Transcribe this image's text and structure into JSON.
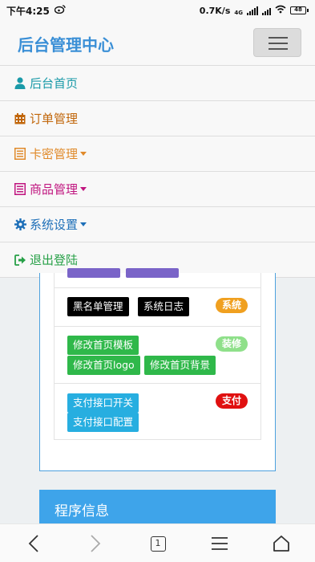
{
  "status_bar": {
    "time": "下午4:25",
    "speed": "0.7K/s",
    "network": "4G",
    "battery": "48"
  },
  "header": {
    "title": "后台管理中心"
  },
  "nav": [
    {
      "label": "后台首页",
      "icon": "user-icon",
      "color": "#1a9aa8"
    },
    {
      "label": "订单管理",
      "icon": "calendar-icon",
      "color": "#c1660a"
    },
    {
      "label": "卡密管理",
      "icon": "list-icon",
      "color": "#e08a2a",
      "dropdown": true
    },
    {
      "label": "商品管理",
      "icon": "list-icon",
      "color": "#c0157f",
      "dropdown": true
    },
    {
      "label": "系统设置",
      "icon": "gear-icon",
      "color": "#1d6fb8",
      "dropdown": true
    },
    {
      "label": "退出登陆",
      "icon": "sign-out-icon",
      "color": "#27a047"
    }
  ],
  "groups": [
    {
      "badge": "系统",
      "badge_color": "#f0a020",
      "buttons": [
        "黑名单管理",
        "系统日志"
      ],
      "button_color": "#000000"
    },
    {
      "badge": "装修",
      "badge_color": "#8fe08a",
      "buttons": [
        "修改首页模板",
        "修改首页logo",
        "修改首页背景"
      ],
      "button_color": "#2fb84a"
    },
    {
      "badge": "支付",
      "badge_color": "#e01010",
      "buttons": [
        "支付接口开关",
        "支付接口配置"
      ],
      "button_color": "#27aee0"
    }
  ],
  "info_panel": {
    "title": "程序信息"
  },
  "browser_bar": {
    "tab_count": "1"
  }
}
